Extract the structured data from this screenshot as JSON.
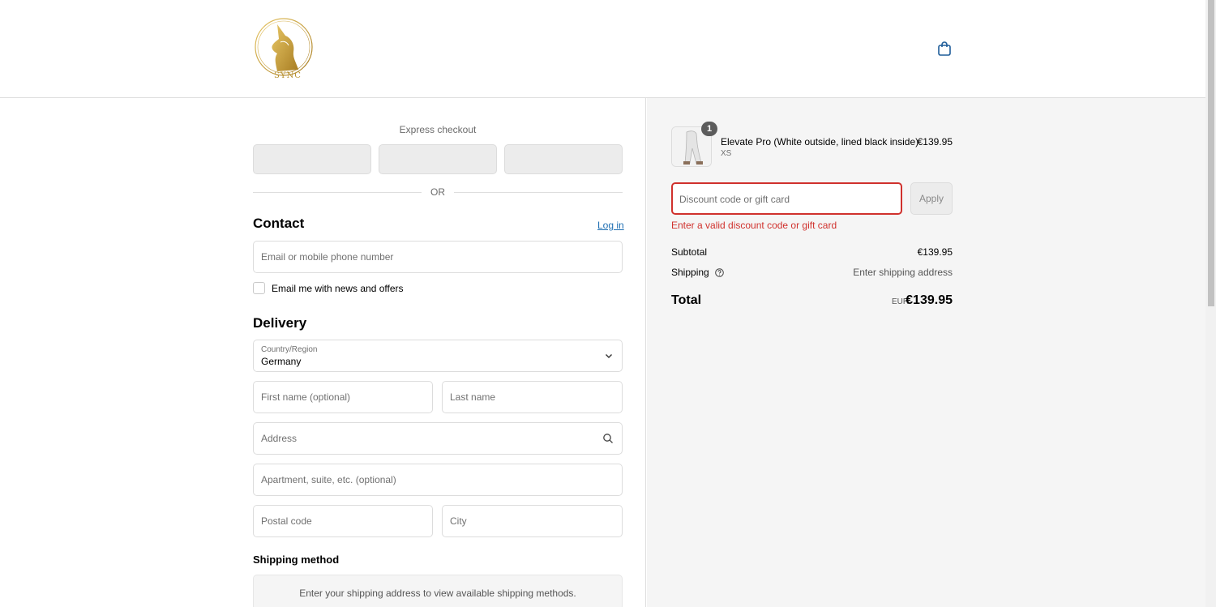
{
  "header": {
    "logo_text": "SYNC",
    "cart_icon": "shopping-bag-icon"
  },
  "express": {
    "title": "Express checkout",
    "or_text": "OR"
  },
  "contact": {
    "title": "Contact",
    "login_label": "Log in",
    "email_placeholder": "Email or mobile phone number",
    "news_label": "Email me with news and offers"
  },
  "delivery": {
    "title": "Delivery",
    "country_label": "Country/Region",
    "country_value": "Germany",
    "first_name_placeholder": "First name (optional)",
    "last_name_placeholder": "Last name",
    "address_placeholder": "Address",
    "apartment_placeholder": "Apartment, suite, etc. (optional)",
    "postal_placeholder": "Postal code",
    "city_placeholder": "City"
  },
  "shipping": {
    "title": "Shipping method",
    "message": "Enter your shipping address to view available shipping methods."
  },
  "order": {
    "product_name": "Elevate Pro (White outside, lined black inside)",
    "variant": "XS",
    "quantity": "1",
    "price": "€139.95"
  },
  "discount": {
    "placeholder": "Discount code or gift card",
    "apply_label": "Apply",
    "error": "Enter a valid discount code or gift card"
  },
  "summary": {
    "subtotal_label": "Subtotal",
    "subtotal_value": "€139.95",
    "shipping_label": "Shipping",
    "shipping_value": "Enter shipping address",
    "total_label": "Total",
    "currency": "EUR",
    "total_value": "€139.95"
  },
  "colors": {
    "error": "#d0312d",
    "link": "#1f6fb3",
    "gold": "#c9a23f"
  }
}
